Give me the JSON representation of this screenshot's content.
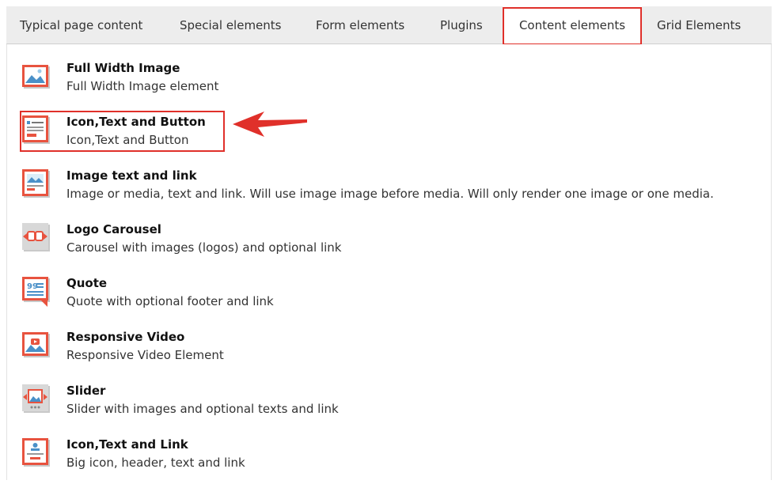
{
  "tabs": [
    {
      "label": "Typical page content",
      "active": false
    },
    {
      "label": "Special elements",
      "active": false
    },
    {
      "label": "Form elements",
      "active": false
    },
    {
      "label": "Plugins",
      "active": false
    },
    {
      "label": "Content elements",
      "active": true
    },
    {
      "label": "Grid Elements",
      "active": false
    }
  ],
  "items": [
    {
      "title": "Full Width Image",
      "description": "Full Width Image element",
      "icon": "full-width-image-icon"
    },
    {
      "title": "Icon,Text and Button",
      "description": "Icon,Text and Button",
      "icon": "icon-text-button-icon"
    },
    {
      "title": "Image text and link",
      "description": "Image or media, text and link. Will use image image before media. Will only render one image or one media.",
      "icon": "image-text-link-icon"
    },
    {
      "title": "Logo Carousel",
      "description": "Carousel with images (logos) and optional link",
      "icon": "logo-carousel-icon"
    },
    {
      "title": "Quote",
      "description": "Quote with optional footer and link",
      "icon": "quote-icon"
    },
    {
      "title": "Responsive Video",
      "description": "Responsive Video Element",
      "icon": "responsive-video-icon"
    },
    {
      "title": "Slider",
      "description": "Slider with images and optional texts and link",
      "icon": "slider-icon"
    },
    {
      "title": "Icon,Text and Link",
      "description": "Big icon, header, text and link",
      "icon": "icon-text-link-icon"
    }
  ],
  "colors": {
    "highlight": "#e0302a",
    "icon_accent": "#e8533f",
    "icon_blue": "#4a90c8"
  }
}
